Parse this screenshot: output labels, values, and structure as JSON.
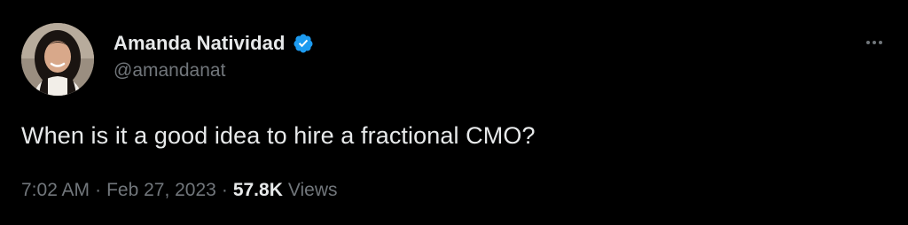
{
  "author": {
    "name": "Amanda Natividad",
    "handle": "@amandanat",
    "verified": true,
    "verified_color": "#1d9bf0",
    "avatar_icon": "profile-photo"
  },
  "tweet": {
    "text": "When is it a good idea to hire a fractional CMO?"
  },
  "meta": {
    "time": "7:02 AM",
    "separator": "·",
    "date": "Feb 27, 2023",
    "views_count": "57.8K",
    "views_label": "Views"
  },
  "more_menu": {
    "icon": "more-horizontal-icon"
  },
  "colors": {
    "background": "#000000",
    "primary_text": "#e7e9ea",
    "secondary_text": "#71767b",
    "accent": "#1d9bf0"
  }
}
